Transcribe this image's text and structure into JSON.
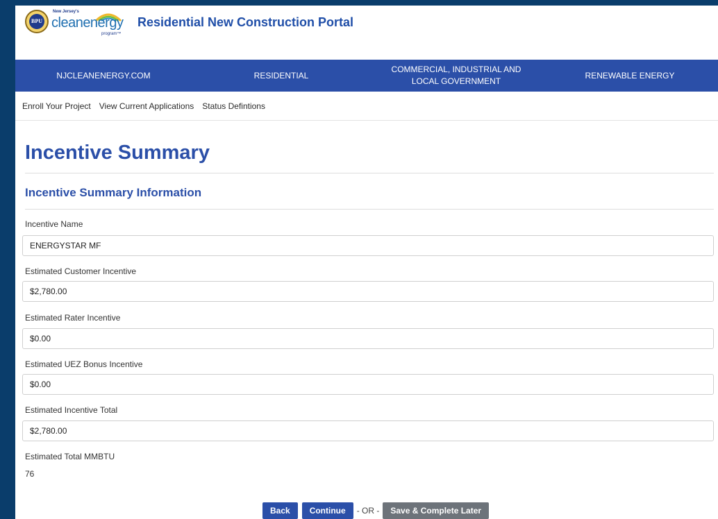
{
  "header": {
    "logo": {
      "seal_text": "BPU",
      "small_text": "New Jersey's",
      "wordmark": "cleanenergy",
      "program_text": "program™"
    },
    "portal_title": "Residential New Construction Portal"
  },
  "nav": [
    {
      "label": "NJCLEANENERGY.COM"
    },
    {
      "label": "RESIDENTIAL"
    },
    {
      "label": "COMMERCIAL, INDUSTRIAL AND LOCAL GOVERNMENT"
    },
    {
      "label": "RENEWABLE ENERGY"
    }
  ],
  "subnav": [
    {
      "label": "Enroll Your Project"
    },
    {
      "label": "View Current Applications"
    },
    {
      "label": "Status Defintions"
    }
  ],
  "page_title": "Incentive Summary",
  "section_title": "Incentive Summary Information",
  "fields": [
    {
      "label": "Incentive Name",
      "value": "ENERGYSTAR MF"
    },
    {
      "label": "Estimated Customer Incentive",
      "value": "$2,780.00"
    },
    {
      "label": "Estimated Rater Incentive",
      "value": "$0.00"
    },
    {
      "label": "Estimated UEZ Bonus Incentive",
      "value": "$0.00"
    },
    {
      "label": "Estimated Incentive Total",
      "value": "$2,780.00"
    }
  ],
  "mmbtu": {
    "label": "Estimated Total MMBTU",
    "value": "76"
  },
  "actions": {
    "back": "Back",
    "continue": "Continue",
    "or": "- OR -",
    "save_later": "Save & Complete Later"
  },
  "colors": {
    "background": "#0a3d6b",
    "nav": "#2b4fa8",
    "heading": "#2b4fa8",
    "secondary_button": "#6d737a"
  }
}
